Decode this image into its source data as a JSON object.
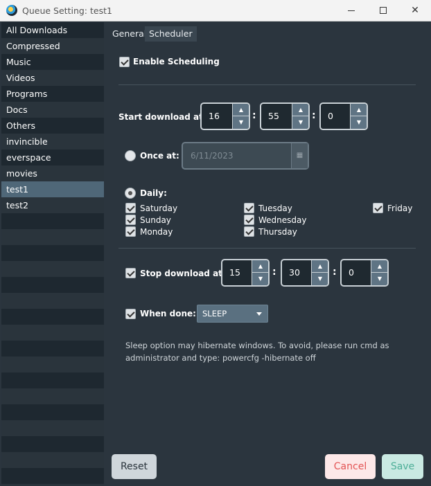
{
  "window": {
    "title": "Queue Setting: test1",
    "min_glyph": "",
    "max_glyph": "",
    "close_glyph": "✕"
  },
  "sidebar": {
    "items": [
      {
        "label": "All Downloads"
      },
      {
        "label": "Compressed"
      },
      {
        "label": "Music"
      },
      {
        "label": "Videos"
      },
      {
        "label": "Programs"
      },
      {
        "label": "Docs"
      },
      {
        "label": "Others"
      },
      {
        "label": "invincible"
      },
      {
        "label": "everspace"
      },
      {
        "label": "movies"
      },
      {
        "label": "test1",
        "selected": true
      },
      {
        "label": "test2"
      }
    ]
  },
  "tabs": {
    "general": "General",
    "scheduler": "Scheduler"
  },
  "scheduler": {
    "enable_label": "Enable Scheduling",
    "enable_checked": true,
    "start_label": "Start download at:",
    "start_hour": "16",
    "start_minute": "55",
    "start_second": "0",
    "colon": ":",
    "once_label": "Once at:",
    "once_date": "6/11/2023",
    "daily_label": "Daily:",
    "days": {
      "saturday": "Saturday",
      "sunday": "Sunday",
      "monday": "Monday",
      "tuesday": "Tuesday",
      "wednesday": "Wednesday",
      "thursday": "Thursday",
      "friday": "Friday"
    },
    "stop_label": "Stop download at:",
    "stop_hour": "15",
    "stop_minute": "30",
    "stop_second": "0",
    "when_done_label": "When done:",
    "when_done_value": "SLEEP",
    "note": "Sleep option may hibernate windows. To avoid, please run cmd as administrator and type: powercfg -hibernate off"
  },
  "glyphs": {
    "up": "▲",
    "down": "▼",
    "calendar": "▦"
  },
  "buttons": {
    "reset": "Reset",
    "cancel": "Cancel",
    "save": "Save"
  },
  "colors": {
    "background": "#2b353e",
    "selected_row": "#4f6778",
    "cancel_text": "#e35454",
    "save_text": "#4cae97"
  }
}
